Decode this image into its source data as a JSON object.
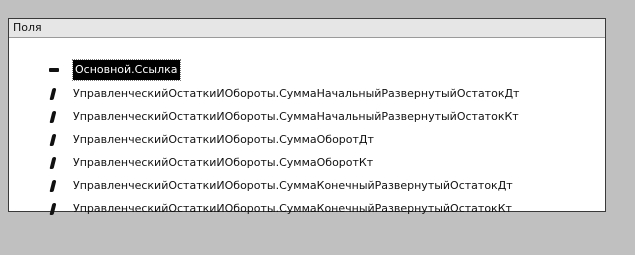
{
  "panel": {
    "header": "Поля",
    "items": [
      {
        "label": "Основной.Ссылка",
        "icon": "dash-icon",
        "selected": true
      },
      {
        "label": "УправленческийОстаткиИОбороты.СуммаНачальныйРазвернутыйОстатокДт",
        "icon": "feather-icon",
        "selected": false
      },
      {
        "label": "УправленческийОстаткиИОбороты.СуммаНачальныйРазвернутыйОстатокКт",
        "icon": "feather-icon",
        "selected": false
      },
      {
        "label": "УправленческийОстаткиИОбороты.СуммаОборотДт",
        "icon": "feather-icon",
        "selected": false
      },
      {
        "label": "УправленческийОстаткиИОбороты.СуммаОборотКт",
        "icon": "feather-icon",
        "selected": false
      },
      {
        "label": "УправленческийОстаткиИОбороты.СуммаКонечныйРазвернутыйОстатокДт",
        "icon": "feather-icon",
        "selected": false
      },
      {
        "label": "УправленческийОстаткиИОбороты.СуммаКонечныйРазвернутыйОстатокКт",
        "icon": "feather-icon",
        "selected": false
      }
    ]
  }
}
